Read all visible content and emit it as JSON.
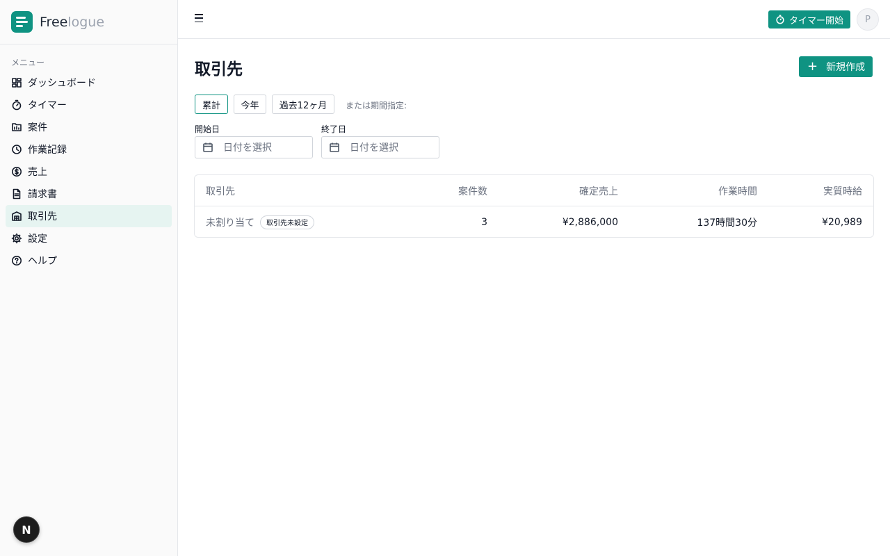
{
  "app": {
    "logo_main": "Free",
    "logo_light": "logue",
    "accent": "#0f9382"
  },
  "sidebar": {
    "menu_label": "メニュー",
    "items": [
      {
        "label": "ダッシュボード",
        "icon": "dashboard-icon"
      },
      {
        "label": "タイマー",
        "icon": "timer-icon"
      },
      {
        "label": "案件",
        "icon": "folder-icon"
      },
      {
        "label": "作業記録",
        "icon": "clock-icon"
      },
      {
        "label": "売上",
        "icon": "dollar-icon"
      },
      {
        "label": "請求書",
        "icon": "document-icon"
      },
      {
        "label": "取引先",
        "icon": "building-icon",
        "active": true
      },
      {
        "label": "設定",
        "icon": "gear-icon"
      },
      {
        "label": "ヘルプ",
        "icon": "help-icon"
      }
    ],
    "badge": "N"
  },
  "header": {
    "timer_button": "タイマー開始",
    "avatar_initial": "P"
  },
  "main": {
    "title": "取引先",
    "new_button": "新規作成",
    "ranges": [
      "累計",
      "今年",
      "過去12ヶ月"
    ],
    "selected_range": "累計",
    "range_hint": "または期間指定:",
    "start_label": "開始日",
    "end_label": "終了日",
    "date_placeholder": "日付を選択",
    "table": {
      "headers": [
        "取引先",
        "案件数",
        "確定売上",
        "作業時間",
        "実質時給"
      ],
      "rows": [
        {
          "client": "未割り当て",
          "tag": "取引先未設定",
          "projects": "3",
          "revenue": "¥2,886,000",
          "hours": "137時間30分",
          "hourly": "¥20,989"
        }
      ]
    }
  }
}
